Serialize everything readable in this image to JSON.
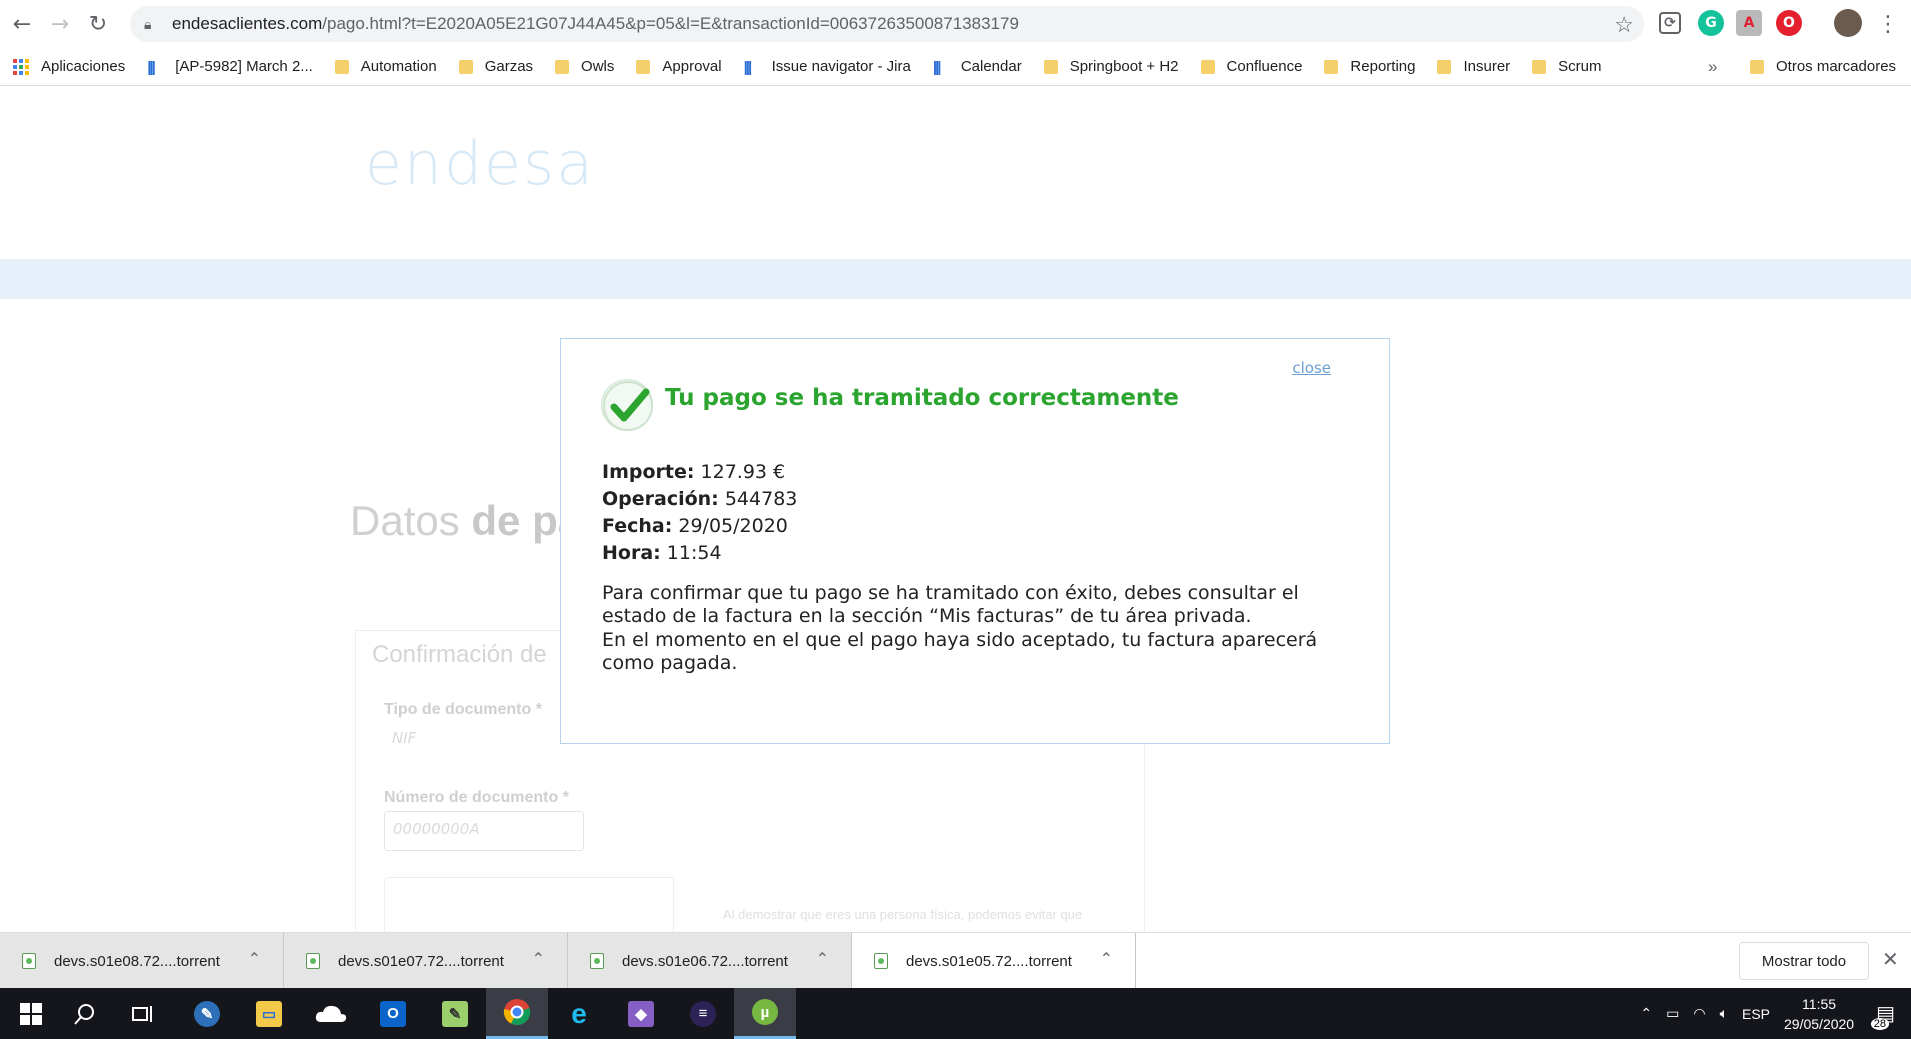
{
  "browser": {
    "url_domain": "endesaclientes.com",
    "url_path": "/pago.html?t=E2020A05E21G07J44A45&p=05&l=E&transactionId=00637263500871383179",
    "bookmarks": [
      {
        "label": "Aplicaciones",
        "icon": "apps-icon"
      },
      {
        "label": "[AP-5982] March 2...",
        "icon": "jira-icon"
      },
      {
        "label": "Automation",
        "icon": "folder-icon"
      },
      {
        "label": "Garzas",
        "icon": "folder-icon"
      },
      {
        "label": "Owls",
        "icon": "folder-icon"
      },
      {
        "label": "Approval",
        "icon": "folder-icon"
      },
      {
        "label": "Issue navigator - Jira",
        "icon": "jira-icon"
      },
      {
        "label": "Calendar",
        "icon": "jira-icon"
      },
      {
        "label": "Springboot + H2",
        "icon": "folder-icon"
      },
      {
        "label": "Confluence",
        "icon": "folder-icon"
      },
      {
        "label": "Reporting",
        "icon": "folder-icon"
      },
      {
        "label": "Insurer",
        "icon": "folder-icon"
      },
      {
        "label": "Scrum",
        "icon": "folder-icon"
      }
    ],
    "more_bookmarks": "»",
    "other_bookmarks": "Otros marcadores"
  },
  "page": {
    "logo": "endesa",
    "bg_heading_light": "Datos ",
    "bg_heading_bold": "de pa",
    "bg_form_title": "Confirmación de",
    "doc_type_label": "Tipo de documento *",
    "doc_type_value": "NIF",
    "doc_number_label": "Número de documento *",
    "doc_number_placeholder": "00000000A",
    "captcha_note": "Al demostrar que eres una persona física, podemos evitar que"
  },
  "modal": {
    "close_label": "close",
    "title": "Tu pago se ha tramitado correctamente",
    "details": [
      {
        "label": "Importe:",
        "value": "127.93 €"
      },
      {
        "label": "Operación:",
        "value": "544783"
      },
      {
        "label": "Fecha:",
        "value": "29/05/2020"
      },
      {
        "label": "Hora:",
        "value": "11:54"
      }
    ],
    "paragraph1": "Para confirmar que tu pago se ha tramitado con éxito, debes consultar el estado de la factura en la sección “Mis facturas” de tu área privada.",
    "paragraph2": "En el momento en el que el pago haya sido aceptado, tu factura aparecerá como pagada.",
    "accent_color": "#2ba52f"
  },
  "downloads": {
    "items": [
      "devs.s01e08.72....torrent",
      "devs.s01e07.72....torrent",
      "devs.s01e06.72....torrent",
      "devs.s01e05.72....torrent"
    ],
    "show_all": "Mostrar todo"
  },
  "taskbar": {
    "language": "ESP",
    "time": "11:55",
    "date": "29/05/2020",
    "notification_count": "28"
  }
}
